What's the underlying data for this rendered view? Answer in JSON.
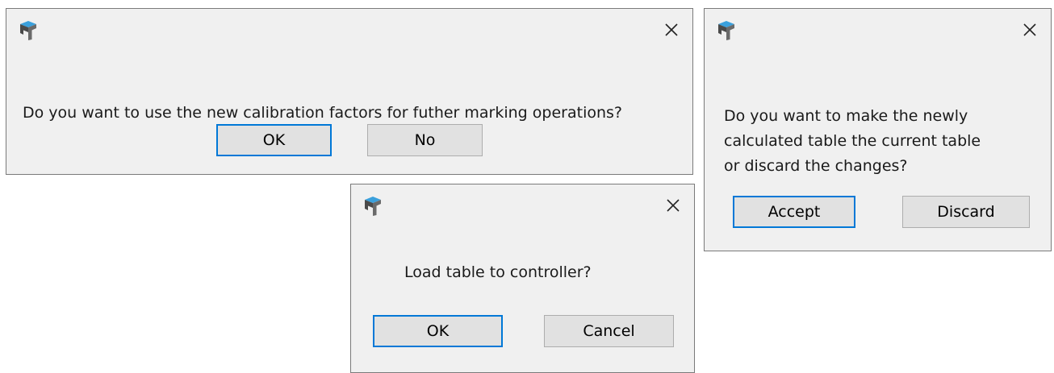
{
  "colors": {
    "dialog_bg": "#f0f0f0",
    "accent": "#0078d7",
    "button_bg": "#e1e1e1"
  },
  "icons": {
    "app": "app-logo-icon",
    "close": "close-icon"
  },
  "dialog_calibration": {
    "message": "Do you want to use the new calibration factors for futher marking operations?",
    "ok_label": "OK",
    "no_label": "No"
  },
  "dialog_table": {
    "message_lines": [
      "Do you want to make the newly",
      "calculated table the current table",
      "or discard the changes?"
    ],
    "accept_label": "Accept",
    "discard_label": "Discard"
  },
  "dialog_load": {
    "message": "Load table to controller?",
    "ok_label": "OK",
    "cancel_label": "Cancel"
  }
}
